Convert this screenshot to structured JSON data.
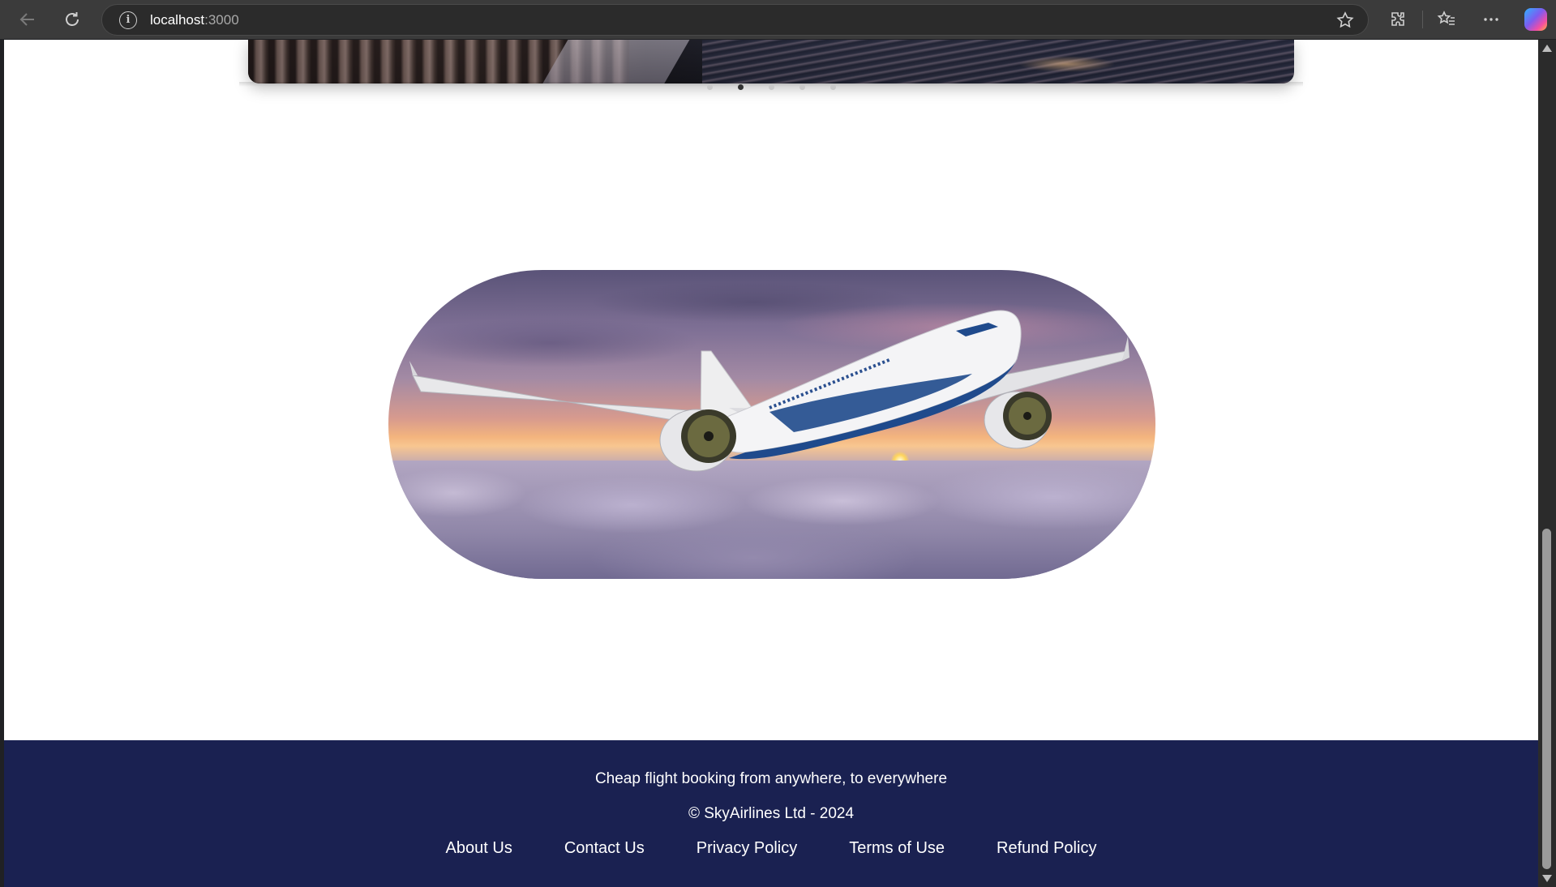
{
  "browser": {
    "url_host": "localhost",
    "url_port": ":3000",
    "icons": {
      "back": "back-arrow-icon",
      "reload": "reload-icon",
      "site_info": "info-icon",
      "favorite": "star-icon",
      "extensions": "puzzle-icon",
      "favorites": "favorites-icon",
      "more": "more-icon",
      "copilot": "copilot-icon"
    }
  },
  "carousel": {
    "dot_count": 5,
    "active_index": 1
  },
  "hero": {
    "image": "airplane-over-clouds-at-sunset"
  },
  "footer": {
    "tagline": "Cheap flight booking from anywhere, to everywhere",
    "copyright": "© SkyAirlines Ltd - 2024",
    "links": [
      "About Us",
      "Contact Us",
      "Privacy Policy",
      "Terms of Use",
      "Refund Policy"
    ],
    "background": "#1a2151"
  }
}
